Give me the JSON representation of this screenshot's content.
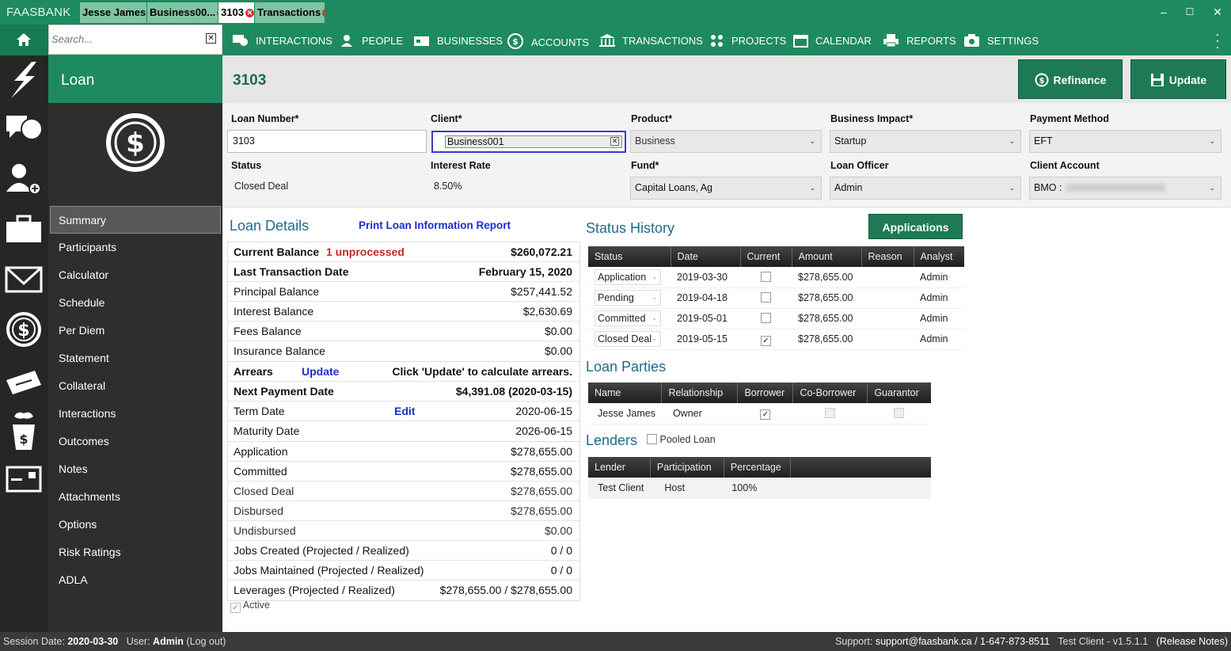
{
  "app": {
    "title": "FAASBANK"
  },
  "tabs": [
    {
      "label": "Jesse James"
    },
    {
      "label": "Business00..."
    },
    {
      "label": "3103"
    },
    {
      "label": "Transactions"
    }
  ],
  "window": {
    "minimize": "–",
    "maximize": "☐",
    "close": "✕"
  },
  "search": {
    "placeholder": "Search..."
  },
  "nav": {
    "interactions": "INTERACTIONS",
    "people": "PEOPLE",
    "businesses": "BUSINESSES",
    "accounts": "ACCOUNTS",
    "transactions": "TRANSACTIONS",
    "projects": "PROJECTS",
    "calendar": "CALENDAR",
    "reports": "REPORTS",
    "settings": "SETTINGS"
  },
  "left": {
    "header": "Loan",
    "menu": [
      "Summary",
      "Participants",
      "Calculator",
      "Schedule",
      "Per Diem",
      "Statement",
      "Collateral",
      "Interactions",
      "Outcomes",
      "Notes",
      "Attachments",
      "Options",
      "Risk Ratings",
      "ADLA"
    ]
  },
  "header": {
    "loan_number": "3103",
    "refinance": "Refinance",
    "update": "Update"
  },
  "form": {
    "loan_number_label": "Loan Number*",
    "loan_number_value": "3103",
    "client_label": "Client*",
    "client_value": "Business001",
    "product_label": "Product*",
    "product_value": "Business",
    "business_impact_label": "Business Impact*",
    "business_impact_value": "Startup",
    "payment_method_label": "Payment Method",
    "payment_method_value": "EFT",
    "status_label": "Status",
    "status_value": "Closed Deal",
    "interest_rate_label": "Interest Rate",
    "interest_rate_value": "8.50%",
    "fund_label": "Fund*",
    "fund_value": "Capital Loans, Ag",
    "loan_officer_label": "Loan Officer",
    "loan_officer_value": "Admin",
    "client_account_label": "Client Account",
    "client_account_value": "BMO :"
  },
  "loan_details": {
    "title": "Loan Details",
    "print_link": "Print Loan Information Report",
    "current_balance_label": "Current Balance",
    "unprocessed": "1 unprocessed",
    "current_balance": "$260,072.21",
    "last_txn_label": "Last Transaction Date",
    "last_txn": "February 15, 2020",
    "principal_label": "Principal Balance",
    "principal": "$257,441.52",
    "interest_label": "Interest Balance",
    "interest": "$2,630.69",
    "fees_label": "Fees Balance",
    "fees": "$0.00",
    "insurance_label": "Insurance Balance",
    "insurance": "$0.00",
    "arrears_label": "Arrears",
    "arrears_update": "Update",
    "arrears_value": "Click 'Update' to calculate arrears.",
    "next_payment_label": "Next Payment Date",
    "next_payment": "$4,391.08 (2020-03-15)",
    "term_label": "Term Date",
    "term_edit": "Edit",
    "term_value": "2020-06-15",
    "maturity_label": "Maturity Date",
    "maturity_value": "2026-06-15",
    "application_label": "Application",
    "application_value": "$278,655.00",
    "committed_label": "Committed",
    "committed_value": "$278,655.00",
    "closed_label": "Closed Deal",
    "closed_value": "$278,655.00",
    "disbursed_label": "Disbursed",
    "disbursed_value": "$278,655.00",
    "undisbursed_label": "Undisbursed",
    "undisbursed_value": "$0.00",
    "jobs_created_label": "Jobs Created (Projected / Realized)",
    "jobs_created_value": "0 / 0",
    "jobs_maintained_label": "Jobs Maintained (Projected / Realized)",
    "jobs_maintained_value": "0 / 0",
    "leverages_label": "Leverages (Projected / Realized)",
    "leverages_value": "$278,655.00 / $278,655.00",
    "active_label": "Active"
  },
  "status_history": {
    "title": "Status History",
    "applications_btn": "Applications",
    "columns": [
      "Status",
      "Date",
      "Current",
      "Amount",
      "Reason",
      "Analyst"
    ],
    "rows": [
      {
        "status": "Application",
        "date": "2019-03-30",
        "current": false,
        "amount": "$278,655.00",
        "reason": "",
        "analyst": "Admin"
      },
      {
        "status": "Pending",
        "date": "2019-04-18",
        "current": false,
        "amount": "$278,655.00",
        "reason": "",
        "analyst": "Admin"
      },
      {
        "status": "Committed",
        "date": "2019-05-01",
        "current": false,
        "amount": "$278,655.00",
        "reason": "",
        "analyst": "Admin"
      },
      {
        "status": "Closed Deal",
        "date": "2019-05-15",
        "current": true,
        "amount": "$278,655.00",
        "reason": "",
        "analyst": "Admin"
      }
    ]
  },
  "loan_parties": {
    "title": "Loan Parties",
    "columns": [
      "Name",
      "Relationship",
      "Borrower",
      "Co-Borrower",
      "Guarantor"
    ],
    "rows": [
      {
        "name": "Jesse James",
        "relationship": "Owner",
        "borrower": true,
        "co_borrower": false,
        "guarantor": false
      }
    ]
  },
  "lenders": {
    "title": "Lenders",
    "pooled_label": "Pooled Loan",
    "columns": [
      "Lender",
      "Participation",
      "Percentage"
    ],
    "rows": [
      {
        "lender": "Test Client",
        "participation": "Host",
        "percentage": "100%"
      }
    ]
  },
  "statusbar": {
    "session_label": "Session Date:",
    "session_date": "2020-03-30",
    "user_label": "User:",
    "user": "Admin",
    "logout": "(Log out)",
    "support_label": "Support:",
    "support_email": "support@faasbank.ca",
    "support_phone": "/ 1-647-873-8511",
    "client_version": "Test Client - v1.5.1.1",
    "release_notes": "(Release Notes)"
  },
  "colors": {
    "brand_green": "#1e8a5f",
    "dark_panel": "#2e2e2e",
    "link_blue": "#1a2fc9",
    "alert_red": "#c62828"
  }
}
